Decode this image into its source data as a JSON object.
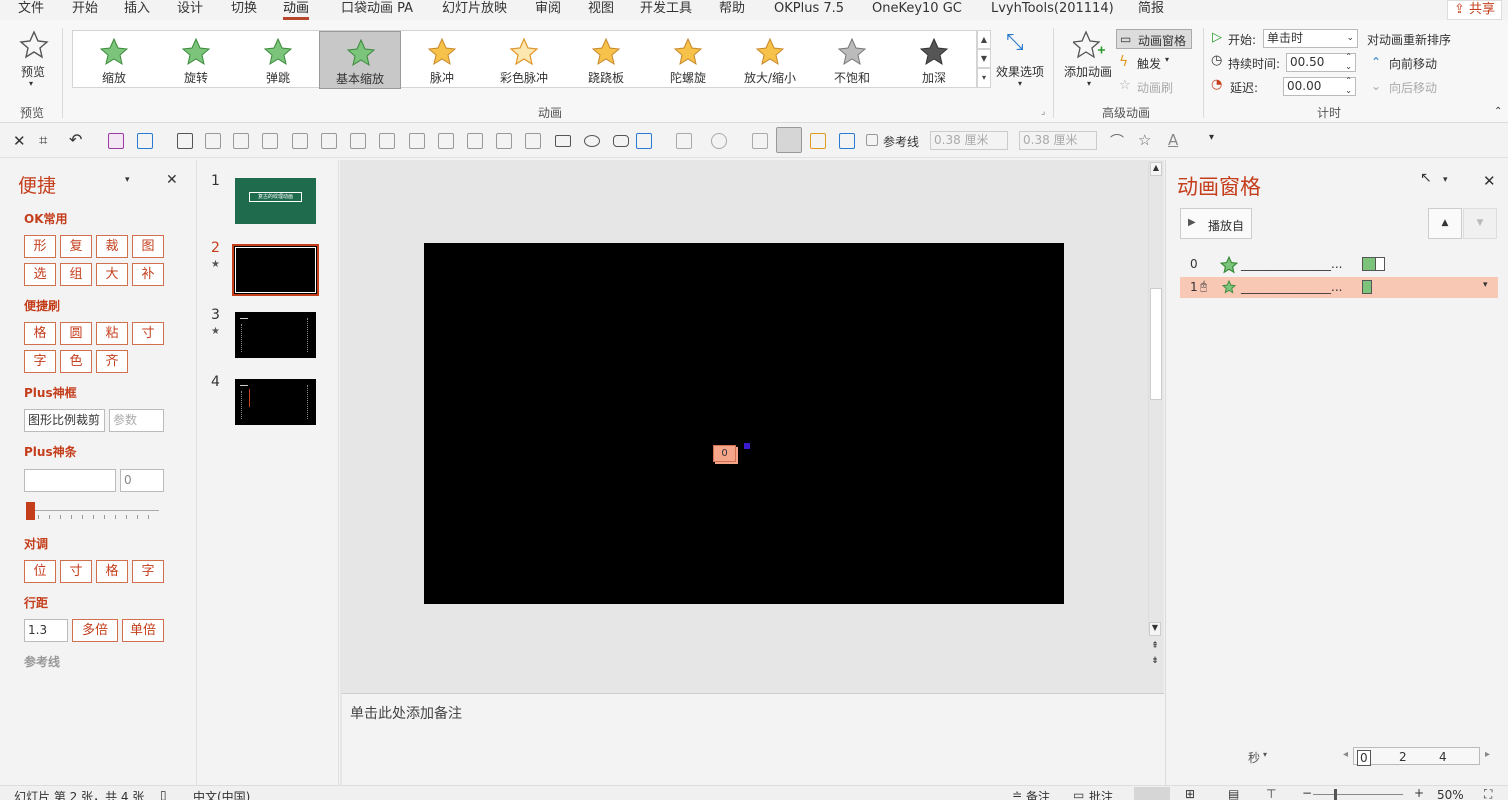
{
  "menubar": {
    "tabs": [
      "文件",
      "开始",
      "插入",
      "设计",
      "切换",
      "动画",
      "口袋动画 PA",
      "幻灯片放映",
      "审阅",
      "视图",
      "开发工具",
      "帮助",
      "OKPlus 7.5",
      "OneKey10 GC",
      "LvyhTools(201114)",
      "简报"
    ],
    "share": "共享"
  },
  "ribbon": {
    "preview_label": "预览",
    "preview_group": "预览",
    "animations": [
      "缩放",
      "旋转",
      "弹跳",
      "基本缩放",
      "脉冲",
      "彩色脉冲",
      "跷跷板",
      "陀螺旋",
      "放大/缩小",
      "不饱和",
      "加深"
    ],
    "selected_animation": "基本缩放",
    "effect_options": "效果选项",
    "animation_group": "动画",
    "add_animation": "添加动画",
    "anim_pane_btn": "动画窗格",
    "trigger": "触发",
    "anim_painter": "动画刷",
    "advanced_group": "高级动画",
    "start_label": "开始:",
    "start_value": "单击时",
    "duration_label": "持续时间:",
    "duration_value": "00.50",
    "delay_label": "延迟:",
    "delay_value": "00.00",
    "reorder_label": "对动画重新排序",
    "move_earlier": "向前移动",
    "move_later": "向后移动",
    "timing_group": "计时"
  },
  "toolbar2": {
    "guides_label": "参考线",
    "width_value": "0.38 厘米",
    "height_value": "0.38 厘米"
  },
  "leftpanel": {
    "title": "便捷",
    "ok_common": "OK常用",
    "ok_buttons": [
      "形",
      "复",
      "裁",
      "图",
      "选",
      "组",
      "大",
      "补"
    ],
    "brush": "便捷刷",
    "brush_buttons": [
      "格",
      "圆",
      "粘",
      "寸",
      "字",
      "色",
      "齐"
    ],
    "plus_frame": "Plus神框",
    "plus_frame_value": "图形比例裁剪",
    "plus_frame_param": "参数",
    "plus_bar": "Plus神条",
    "plus_bar_value": "0",
    "align": "对调",
    "align_buttons": [
      "位",
      "寸",
      "格",
      "字"
    ],
    "line_spacing": "行距",
    "line_spacing_value": "1.3",
    "multi": "多倍",
    "single": "单倍",
    "guides": "参考线"
  },
  "thumbs": [
    {
      "num": "1",
      "star": false,
      "title": "复古的纹理动画"
    },
    {
      "num": "2",
      "star": true
    },
    {
      "num": "3",
      "star": true
    },
    {
      "num": "4",
      "star": false
    }
  ],
  "slide": {
    "tag": "0",
    "notes_placeholder": "单击此处添加备注"
  },
  "animpane": {
    "title": "动画窗格",
    "play_from": "播放自",
    "rows": [
      {
        "index": "0",
        "name": "_______________..."
      },
      {
        "index": "1",
        "name": "_______________..."
      }
    ],
    "seconds": "秒",
    "timeline": [
      "0",
      "2",
      "4"
    ]
  },
  "statusbar": {
    "slide_info": "幻灯片 第 2 张，共 4 张",
    "language": "中文(中国)",
    "notes": "备注",
    "comments": "批注",
    "zoom": "50%"
  },
  "colors": {
    "accent": "#c43e1c",
    "selection": "#f9c8b4",
    "green": "#7cc47c"
  }
}
